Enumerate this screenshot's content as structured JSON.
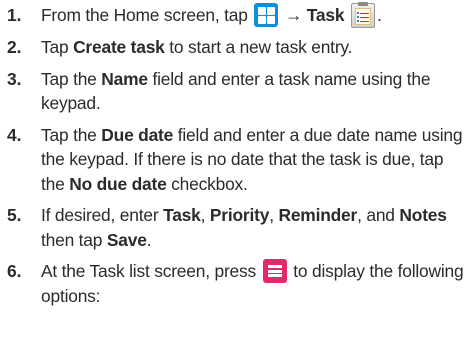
{
  "steps": [
    {
      "num": "1.",
      "pre": "From the Home screen, tap ",
      "arrow": "→",
      "bold": "Task",
      "post": "."
    },
    {
      "num": "2.",
      "pre": "Tap ",
      "bold": "Create task",
      "post": " to start a new task entry."
    },
    {
      "num": "3.",
      "pre": "Tap the ",
      "bold": "Name",
      "post": " field and enter a task name using the keypad."
    },
    {
      "num": "4.",
      "pre": "Tap the ",
      "bold": "Due date",
      "mid": " field and enter a due date name using the keypad. If there is no date that the task is due, tap the ",
      "bold2": "No due date",
      "post": " checkbox."
    },
    {
      "num": "5.",
      "pre": "If desired, enter ",
      "b1": "Task",
      "s1": ", ",
      "b2": "Priority",
      "s2": ", ",
      "b3": "Reminder",
      "s3": ", and ",
      "b4": "Notes",
      "s4": " then tap ",
      "b5": "Save",
      "post": "."
    },
    {
      "num": "6.",
      "pre": "At the Task list screen, press ",
      "post": " to display the following options:"
    }
  ],
  "icons": {
    "apps": "apps-grid-icon",
    "task": "task-clipboard-icon",
    "menu": "menu-key-icon"
  },
  "colors": {
    "apps_icon": "#0f8fd6",
    "menu_icon": "#e8266a",
    "text": "#2b2b2b"
  }
}
